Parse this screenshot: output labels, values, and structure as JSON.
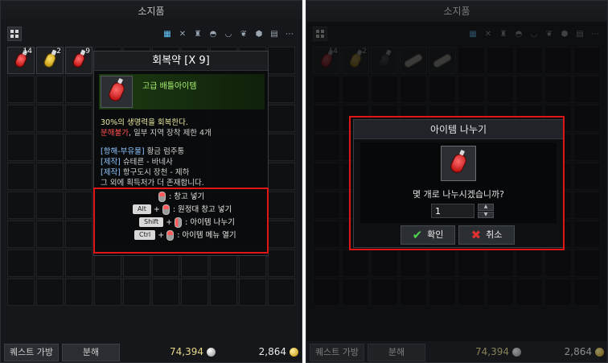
{
  "left": {
    "title": "소지품",
    "slots": [
      {
        "qty": "14",
        "kind": "red-potion"
      },
      {
        "qty": "2",
        "kind": "yellow-potion"
      },
      {
        "qty": "9",
        "kind": "red-potion"
      }
    ],
    "tooltip": {
      "title": "회복약 [X 9]",
      "grade": "고급 배틀아이템",
      "effect": "30%의 생명력을 회복한다.",
      "no_disassemble": "분해불가",
      "restriction": ", 일부 지역 장착 제한 4개",
      "craft_lines": [
        {
          "tag": "[항해-부유물]",
          "text": " 황금 럼주통"
        },
        {
          "tag": "[제작]",
          "text": " 슈테른 - 바네사"
        },
        {
          "tag": "[제작]",
          "text": " 항구도시 장천 - 제하"
        }
      ],
      "craft_more": "그 외에 획득처가 더 존재합니다.",
      "help": [
        {
          "keys": "",
          "action": ": 창고 넣기"
        },
        {
          "keys": "Alt",
          "action": ": 원정대 창고 넣기"
        },
        {
          "keys": "Shift",
          "action": ": 아이템 나누기"
        },
        {
          "keys": "Ctrl",
          "action": ": 아이템 메뉴 열기"
        }
      ]
    },
    "footer": {
      "quest_bag": "퀘스트 가방",
      "decompose": "분해",
      "silver": "74,394",
      "gold": "2,864"
    }
  },
  "right": {
    "title": "소지품",
    "slots": [
      {
        "qty": "14",
        "kind": "red-potion"
      },
      {
        "qty": "2",
        "kind": "yellow-potion"
      },
      {
        "qty": "",
        "kind": "grey-potion"
      },
      {
        "qty": "",
        "kind": "scroll"
      },
      {
        "qty": "",
        "kind": "scroll"
      }
    ],
    "dialog": {
      "title": "아이템 나누기",
      "question": "몇 개로 나누시겠습니까?",
      "quantity": "1",
      "confirm": "확인",
      "cancel": "취소"
    },
    "footer": {
      "quest_bag": "퀘스트 가방",
      "decompose": "분해",
      "silver": "74,394",
      "gold": "2,864"
    }
  },
  "colors": {
    "highlight_box": "#e01515",
    "grade_green": "#a8f070",
    "active_filter": "#66c9ff"
  },
  "filter_icons": [
    "grid-icon",
    "swords-icon",
    "armor-icon",
    "hat-icon",
    "bowl-icon",
    "leaf-icon",
    "gem-icon",
    "scroll-icon",
    "more-icon"
  ]
}
